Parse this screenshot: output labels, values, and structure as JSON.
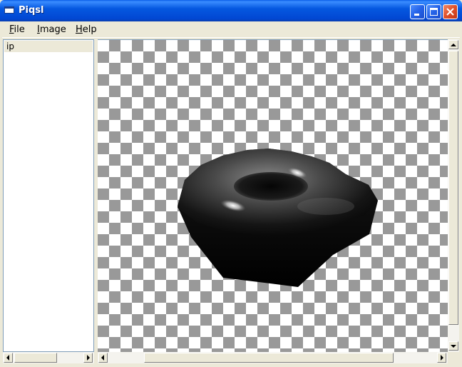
{
  "window": {
    "title": "Piqsl"
  },
  "menu": {
    "items": [
      {
        "label": "File",
        "accel": "F",
        "rest": "ile"
      },
      {
        "label": "Image",
        "accel": "I",
        "rest": "mage"
      },
      {
        "label": "Help",
        "accel": "H",
        "rest": "elp"
      }
    ]
  },
  "sidebar": {
    "items": [
      {
        "label": "ip"
      }
    ]
  },
  "image": {
    "subject": "torus-render",
    "background": "transparency-checkerboard"
  },
  "colors": {
    "title_bar": "#0558e0",
    "chrome": "#ece9d8",
    "checker_dark": "#999999",
    "checker_light": "#ffffff"
  },
  "icons": [
    "app-icon",
    "minimize-icon",
    "maximize-icon",
    "close-icon",
    "scroll-left-arrow-icon",
    "scroll-right-arrow-icon",
    "scroll-up-arrow-icon",
    "scroll-down-arrow-icon"
  ]
}
